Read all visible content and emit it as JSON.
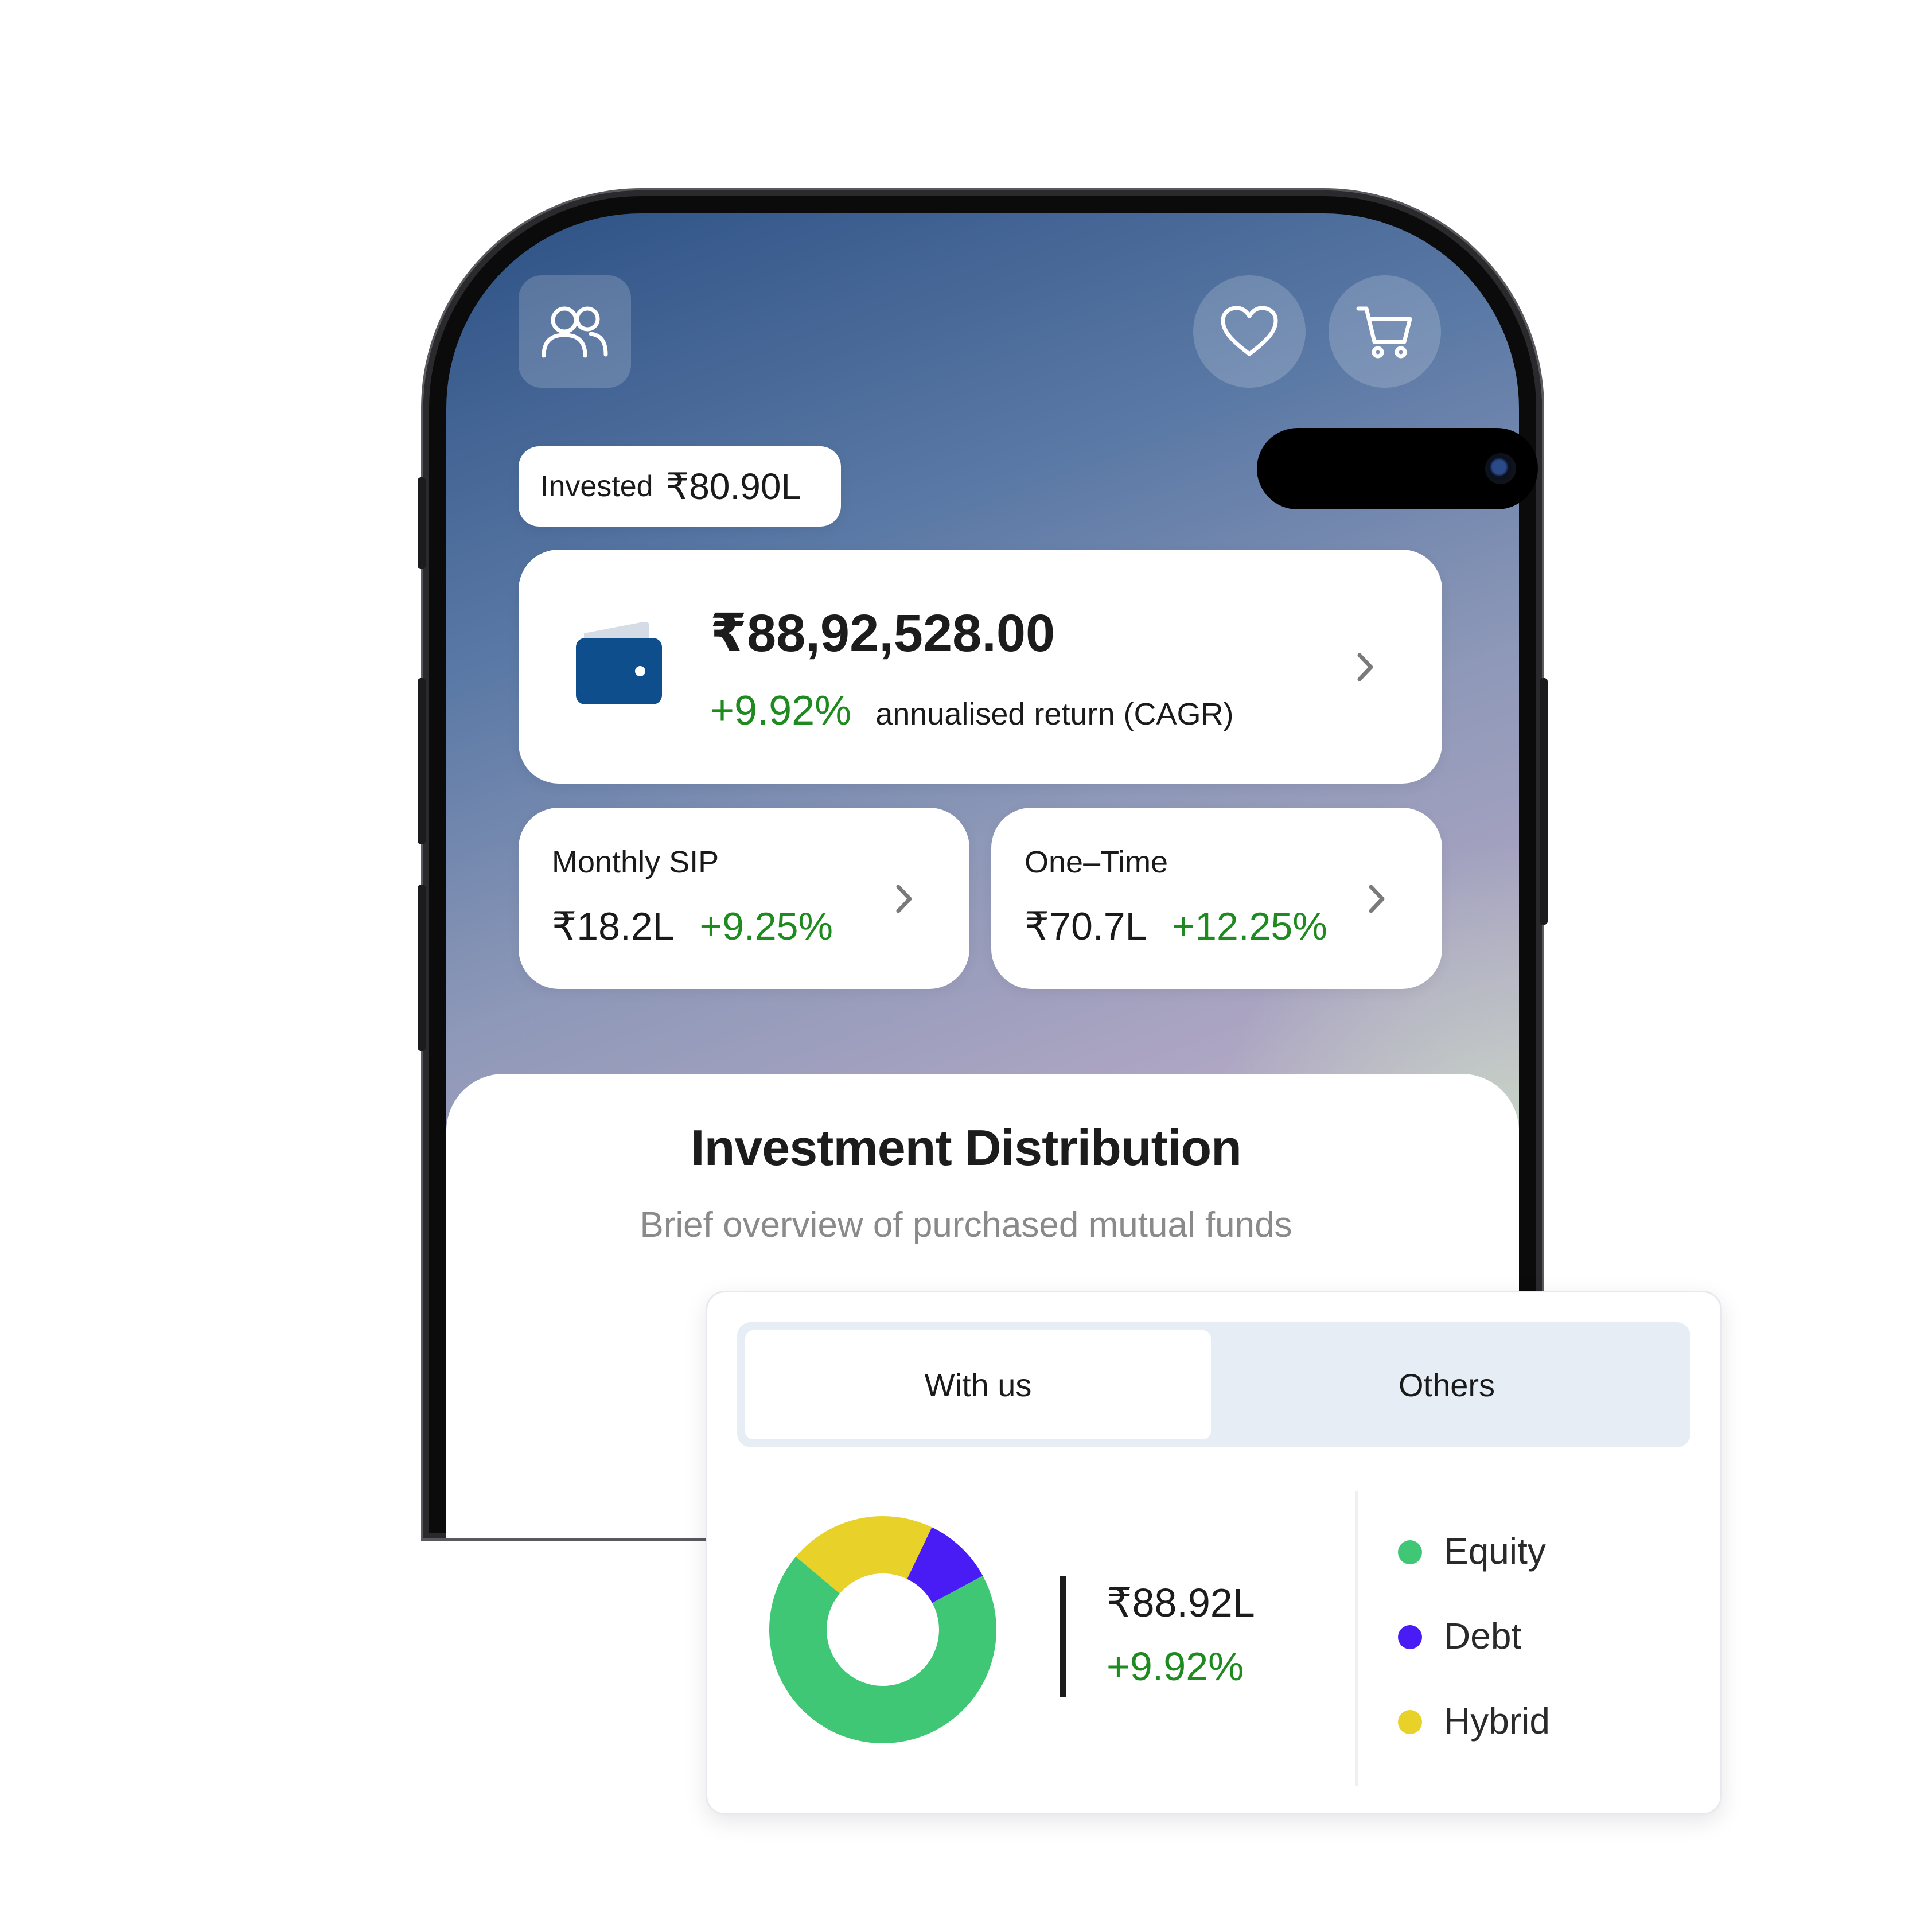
{
  "header": {
    "profile_icon": "users-icon",
    "wishlist_icon": "heart-icon",
    "cart_icon": "cart-icon"
  },
  "invested": {
    "label": "Invested",
    "value": "₹80.90L"
  },
  "portfolio": {
    "icon": "wallet-icon",
    "total_value": "₹88,92,528.00",
    "return_pct": "+9.92%",
    "return_label": "annualised return (CAGR)"
  },
  "sip": {
    "label": "Monthly SIP",
    "value": "₹18.2L",
    "return_pct": "+9.25%"
  },
  "one_time": {
    "label": "One–Time",
    "value": "₹70.7L",
    "return_pct": "+12.25%"
  },
  "distribution": {
    "title": "Investment Distribution",
    "subtitle": "Brief overview of purchased mutual funds",
    "tabs": [
      {
        "label": "With us",
        "active": true
      },
      {
        "label": "Others",
        "active": false
      }
    ],
    "summary_value": "₹88.92L",
    "summary_return": "+9.92%"
  },
  "colors": {
    "equity": "#3fc776",
    "debt": "#4a1cf5",
    "hybrid": "#e8d22a",
    "positive": "#1f8a1f",
    "wallet": "#0f4e8c"
  },
  "chart_data": {
    "type": "pie",
    "categories": [
      "Equity",
      "Debt",
      "Hybrid"
    ],
    "values": [
      69,
      10,
      21
    ],
    "colors": [
      "#3fc776",
      "#4a1cf5",
      "#e8d22a"
    ],
    "legend": [
      "Equity",
      "Debt",
      "Hybrid"
    ],
    "legend_position": "right"
  }
}
